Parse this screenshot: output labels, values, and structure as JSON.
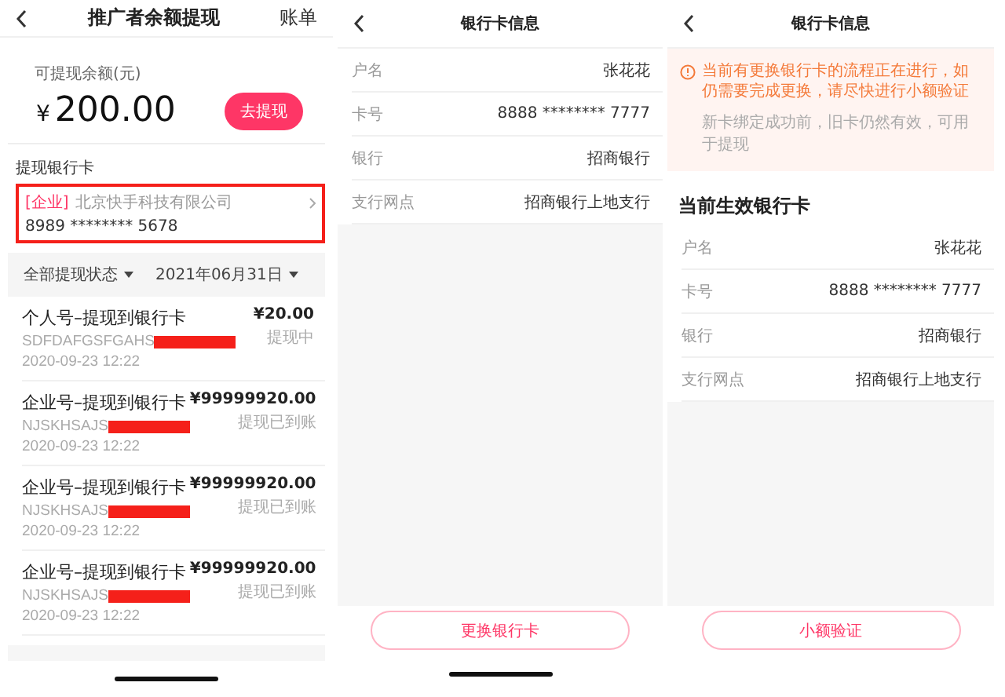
{
  "withdraw_screen": {
    "title": "推广者余额提现",
    "action": "账单",
    "balance_label": "可提现余额(元)",
    "currency": "¥",
    "amount": "200.00",
    "withdraw_button": "去提现",
    "card_section_label": "提现银行卡",
    "card": {
      "tag": "[企业]",
      "company": "北京快手科技有限公司",
      "number": "8989 ******** 5678",
      "highlighted": true
    },
    "filters": [
      {
        "label": "全部提现状态"
      },
      {
        "label": "2021年06月31日"
      }
    ],
    "records": [
      {
        "title": "个人号–提现到银行卡",
        "code": "SDFDAFGSFGAHS",
        "redacted": true,
        "date": "2020-09-23 12:22",
        "amount": "¥20.00",
        "status": "提现中"
      },
      {
        "title": "企业号–提现到银行卡",
        "code": "NJSKHSAJS",
        "redacted": true,
        "date": "2020-09-23 12:22",
        "amount": "¥99999920.00",
        "status": "提现已到账"
      },
      {
        "title": "企业号–提现到银行卡",
        "code": "NJSKHSAJS",
        "redacted": true,
        "date": "2020-09-23 12:22",
        "amount": "¥99999920.00",
        "status": "提现已到账"
      },
      {
        "title": "企业号–提现到银行卡",
        "code": "NJSKHSAJS",
        "redacted": true,
        "date": "2020-09-23 12:22",
        "amount": "¥99999920.00",
        "status": "提现已到账"
      }
    ]
  },
  "card_info_screen": {
    "title": "银行卡信息",
    "fields": [
      {
        "label": "户名",
        "value": "张花花"
      },
      {
        "label": "卡号",
        "value": "8888 ******** 7777"
      },
      {
        "label": "银行",
        "value": "招商银行"
      },
      {
        "label": "支行网点",
        "value": "招商银行上地支行"
      }
    ],
    "button": "更换银行卡"
  },
  "pending_screen": {
    "title": "银行卡信息",
    "notice": {
      "message": "当前有更换银行卡的流程正在进行，如仍需要完成更换，请尽快进行小额验证",
      "hint": "新卡绑定成功前，旧卡仍然有效，可用于提现"
    },
    "section_title": "当前生效银行卡",
    "fields": [
      {
        "label": "户名",
        "value": "张花花"
      },
      {
        "label": "卡号",
        "value": "8888 ******** 7777"
      },
      {
        "label": "银行",
        "value": "招商银行"
      },
      {
        "label": "支行网点",
        "value": "招商银行上地支行"
      }
    ],
    "button": "小额验证"
  }
}
